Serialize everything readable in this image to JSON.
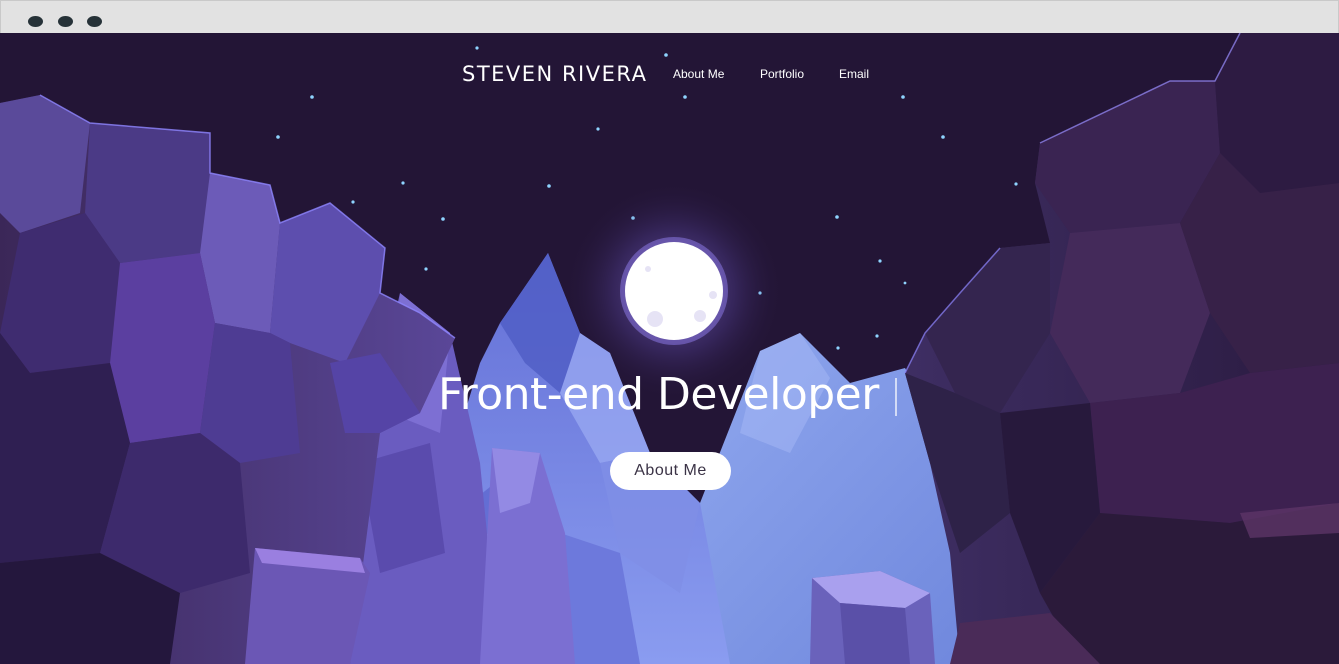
{
  "site": {
    "brand": "STEVEN RIVERA",
    "nav": [
      {
        "label": "About Me"
      },
      {
        "label": "Portfolio"
      },
      {
        "label": "Email"
      }
    ]
  },
  "hero": {
    "title": "Front-end Developer",
    "button_label": "About Me",
    "illustration": "night-canyon-moon-illustration"
  },
  "colors": {
    "sky": "#231536",
    "moon": "#ffffff",
    "mountain_light": "#7b86e0",
    "cliff_dark": "#3a2754",
    "button_bg": "#ffffff",
    "window_chrome": "#e2e2e2",
    "window_dots": "#263238"
  }
}
